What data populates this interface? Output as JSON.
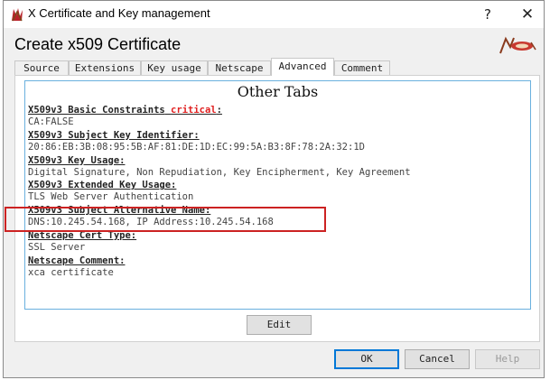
{
  "window": {
    "title": "X Certificate and Key management",
    "help_glyph": "?",
    "close_glyph": "✕"
  },
  "dialog": {
    "title": "Create x509 Certificate"
  },
  "tabs": [
    {
      "label": "Source",
      "active": false
    },
    {
      "label": "Extensions",
      "active": false
    },
    {
      "label": "Key usage",
      "active": false
    },
    {
      "label": "Netscape",
      "active": false
    },
    {
      "label": "Advanced",
      "active": true
    },
    {
      "label": "Comment",
      "active": false
    }
  ],
  "content": {
    "heading": "Other Tabs",
    "sections": [
      {
        "title": "X509v3 Basic Constraints",
        "critical_label": "critical",
        "title_suffix": ":",
        "value": "CA:FALSE"
      },
      {
        "title": "X509v3 Subject Key Identifier:",
        "value": "20:86:EB:3B:08:95:5B:AF:81:DE:1D:EC:99:5A:B3:8F:78:2A:32:1D"
      },
      {
        "title": "X509v3 Key Usage:",
        "value": "Digital Signature, Non Repudiation, Key Encipherment, Key Agreement"
      },
      {
        "title": "X509v3 Extended Key Usage:",
        "value": "TLS Web Server Authentication"
      },
      {
        "title": "X509v3 Subject Alternative Name:",
        "value": "DNS:10.245.54.168, IP Address:10.245.54.168",
        "highlighted": true
      },
      {
        "title": "Netscape Cert Type:",
        "value": "SSL Server"
      },
      {
        "title": "Netscape Comment:",
        "value": "xca certificate"
      }
    ]
  },
  "buttons": {
    "edit": "Edit",
    "ok": "OK",
    "cancel": "Cancel",
    "help": "Help"
  },
  "colors": {
    "critical": "#e02020",
    "highlight_box": "#cc2222",
    "content_border": "#6ab0de",
    "ok_focus": "#0078d7"
  },
  "icons": {
    "app": "certificate-app-icon",
    "brand": "xca-brand-logo-icon"
  }
}
